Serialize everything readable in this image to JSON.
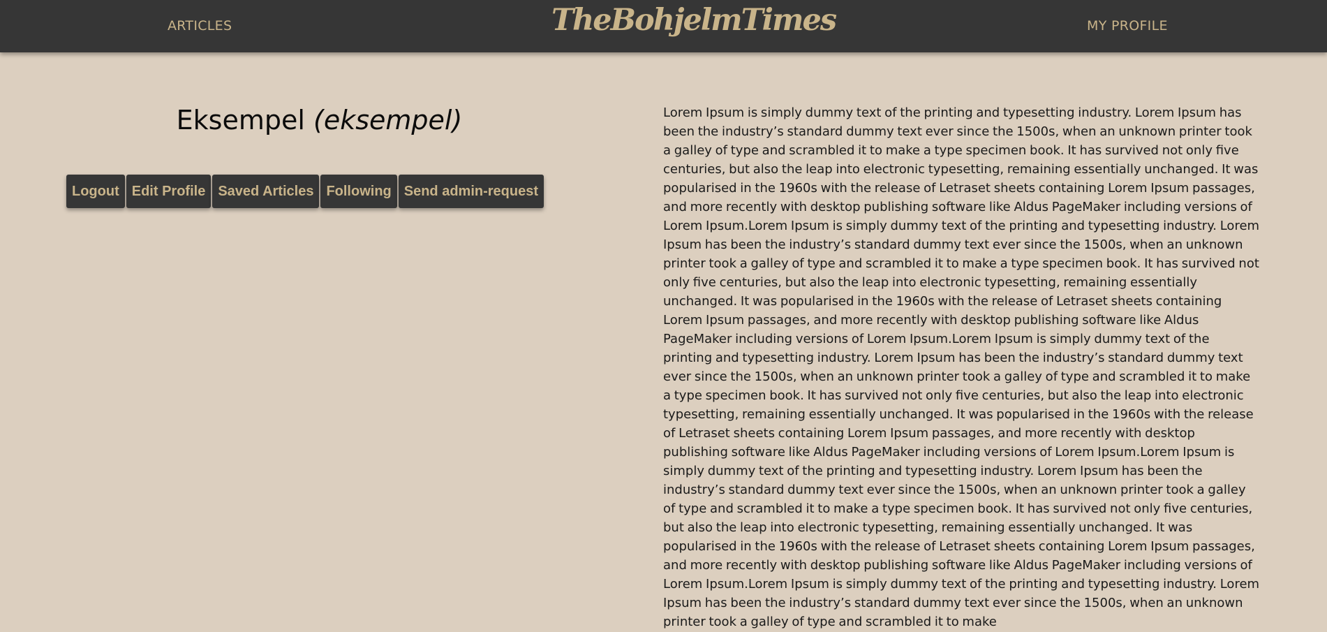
{
  "navbar": {
    "articles_label": "ARTICLES",
    "logo_text": "TheBohjelmTimes",
    "profile_label": "MY PROFILE"
  },
  "profile": {
    "display_name": "Eksempel",
    "username": "(eksempel)"
  },
  "buttons": {
    "logout": "Logout",
    "edit_profile": "Edit Profile",
    "saved_articles": "Saved Articles",
    "following": "Following",
    "admin_request": "Send admin-request"
  },
  "article": {
    "body": "Lorem Ipsum is simply dummy text of the printing and typesetting industry. Lorem Ipsum has been the industry’s standard dummy text ever since the 1500s, when an unknown printer took a galley of type and scrambled it to make a type specimen book. It has survived not only five centuries, but also the leap into electronic typesetting, remaining essentially unchanged. It was popularised in the 1960s with the release of Letraset sheets containing Lorem Ipsum passages, and more recently with desktop publishing software like Aldus PageMaker including versions of Lorem Ipsum.Lorem Ipsum is simply dummy text of the printing and typesetting industry. Lorem Ipsum has been the industry’s standard dummy text ever since the 1500s, when an unknown printer took a galley of type and scrambled it to make a type specimen book. It has survived not only five centuries, but also the leap into electronic typesetting, remaining essentially unchanged. It was popularised in the 1960s with the release of Letraset sheets containing Lorem Ipsum passages, and more recently with desktop publishing software like Aldus PageMaker including versions of Lorem Ipsum.Lorem Ipsum is simply dummy text of the printing and typesetting industry. Lorem Ipsum has been the industry’s standard dummy text ever since the 1500s, when an unknown printer took a galley of type and scrambled it to make a type specimen book. It has survived not only five centuries, but also the leap into electronic typesetting, remaining essentially unchanged. It was popularised in the 1960s with the release of Letraset sheets containing Lorem Ipsum passages, and more recently with desktop publishing software like Aldus PageMaker including versions of Lorem Ipsum.Lorem Ipsum is simply dummy text of the printing and typesetting industry. Lorem Ipsum has been the industry’s standard dummy text ever since the 1500s, when an unknown printer took a galley of type and scrambled it to make a type specimen book. It has survived not only five centuries, but also the leap into electronic typesetting, remaining essentially unchanged. It was popularised in the 1960s with the release of Letraset sheets containing Lorem Ipsum passages, and more recently with desktop publishing software like Aldus PageMaker including versions of Lorem Ipsum.Lorem Ipsum is simply dummy text of the printing and typesetting industry. Lorem Ipsum has been the industry’s standard dummy text ever since the 1500s, when an unknown printer took a galley of type and scrambled it to make"
  },
  "colors": {
    "background": "#dccfbf",
    "navbar": "#363636",
    "accent": "#c9b48a",
    "text": "#1a1a1a"
  }
}
